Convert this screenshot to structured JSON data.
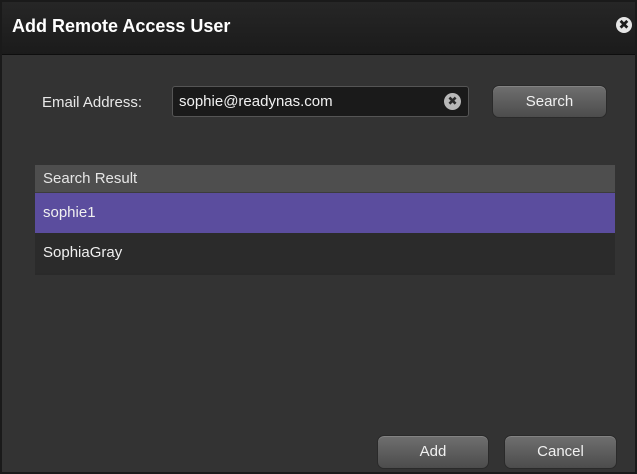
{
  "dialog": {
    "title": "Add Remote Access User",
    "close_icon": "close-icon",
    "close_glyph": "✖"
  },
  "form": {
    "email_label": "Email Address:",
    "email_value": "sophie@readynas.com",
    "clear_icon": "clear-icon",
    "clear_glyph": "✖",
    "search_label": "Search"
  },
  "results": {
    "header": "Search Result",
    "items": [
      {
        "label": "sophie1",
        "selected": true
      },
      {
        "label": "SophiaGray",
        "selected": false
      }
    ]
  },
  "footer": {
    "add_label": "Add",
    "cancel_label": "Cancel"
  },
  "colors": {
    "selected_row": "#5b4d9e",
    "background": "#333333",
    "titlebar": "#1f1f1f"
  }
}
